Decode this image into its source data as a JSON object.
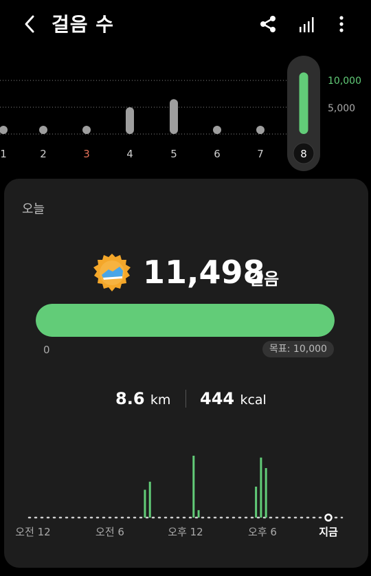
{
  "header": {
    "title": "걸음 수"
  },
  "week": {
    "scale_labels": [
      "10,000",
      "5,000"
    ],
    "days": [
      {
        "label": "1",
        "steps": 300,
        "color": "#cfcfcf"
      },
      {
        "label": "2",
        "steps": 300,
        "color": "#cfcfcf"
      },
      {
        "label": "3",
        "steps": 300,
        "color": "#e5735a"
      },
      {
        "label": "4",
        "steps": 5000,
        "color": "#cfcfcf"
      },
      {
        "label": "5",
        "steps": 6500,
        "color": "#cfcfcf"
      },
      {
        "label": "6",
        "steps": 300,
        "color": "#cfcfcf"
      },
      {
        "label": "7",
        "steps": 700,
        "color": "#cfcfcf"
      },
      {
        "label": "8",
        "steps": 11498,
        "color": "#ffffff"
      }
    ]
  },
  "today": {
    "label": "오늘",
    "steps": "11,498",
    "steps_unit": "걸음",
    "progress_min": "0",
    "goal": "목표: 10,000",
    "progress_fraction": 1.0,
    "distance_value": "8.6",
    "distance_unit": "km",
    "calories_value": "444",
    "calories_unit": "kcal"
  },
  "day_chart": {
    "x_labels": [
      "오전 12",
      "오전 6",
      "오후 12",
      "오후 6",
      "지금"
    ],
    "bars": [
      {
        "hour": 9.3,
        "value": 0.45
      },
      {
        "hour": 9.7,
        "value": 0.58
      },
      {
        "hour": 13.2,
        "value": 1.0
      },
      {
        "hour": 13.6,
        "value": 0.12
      },
      {
        "hour": 18.2,
        "value": 0.5
      },
      {
        "hour": 18.6,
        "value": 0.97
      },
      {
        "hour": 19.0,
        "value": 0.8
      }
    ]
  },
  "colors": {
    "accent": "#62cc78",
    "background": "#000000",
    "card": "#1d1d1d"
  },
  "icons": [
    "back-icon",
    "share-icon",
    "bar-chart-icon",
    "more-icon",
    "shoe-badge-icon"
  ]
}
